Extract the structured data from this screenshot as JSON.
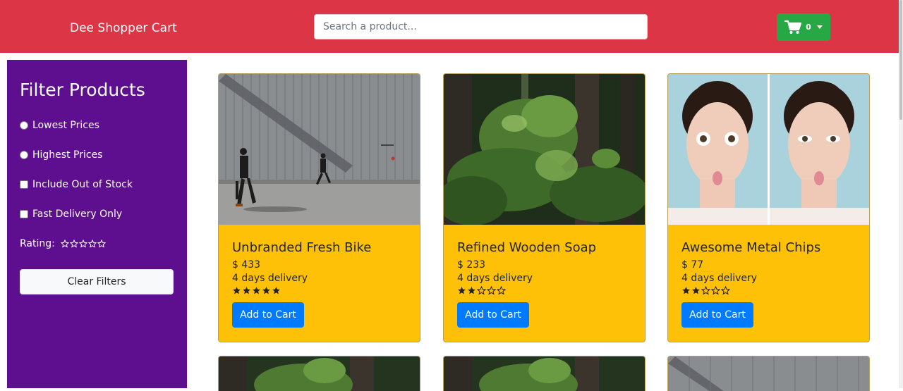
{
  "navbar": {
    "brand": "Dee Shopper Cart",
    "search_placeholder": "Search a product...",
    "cart_count": "0",
    "color": "#dc3545",
    "cart_color": "#28a745"
  },
  "sidebar": {
    "title": "Filter Products",
    "options": [
      {
        "label": "Lowest Prices",
        "type": "radio",
        "checked": false
      },
      {
        "label": "Highest Prices",
        "type": "radio",
        "checked": false
      },
      {
        "label": "Include Out of Stock",
        "type": "checkbox",
        "checked": false
      },
      {
        "label": "Fast Delivery Only",
        "type": "checkbox",
        "checked": false
      }
    ],
    "rating_label": "Rating:",
    "rating_value": 0,
    "clear_label": "Clear Filters",
    "color": "#5e0f8f"
  },
  "products": [
    {
      "name": "Unbranded Fresh Bike",
      "price": "$ 433",
      "delivery": "4 days delivery",
      "rating": 5,
      "button": "Add to Cart",
      "image": "street-scene"
    },
    {
      "name": "Refined Wooden Soap",
      "price": "$ 233",
      "delivery": "4 days delivery",
      "rating": 2,
      "button": "Add to Cart",
      "image": "forest"
    },
    {
      "name": "Awesome Metal Chips",
      "price": "$ 77",
      "delivery": "4 days delivery",
      "rating": 2,
      "button": "Add to Cart",
      "image": "woman-portrait"
    }
  ],
  "icons": {
    "cart": "shopping-cart-icon",
    "dropdown": "caret-down-icon",
    "star_filled": "★",
    "star_empty": "☆"
  },
  "colors": {
    "card": "#ffc107",
    "button": "#007bff"
  }
}
